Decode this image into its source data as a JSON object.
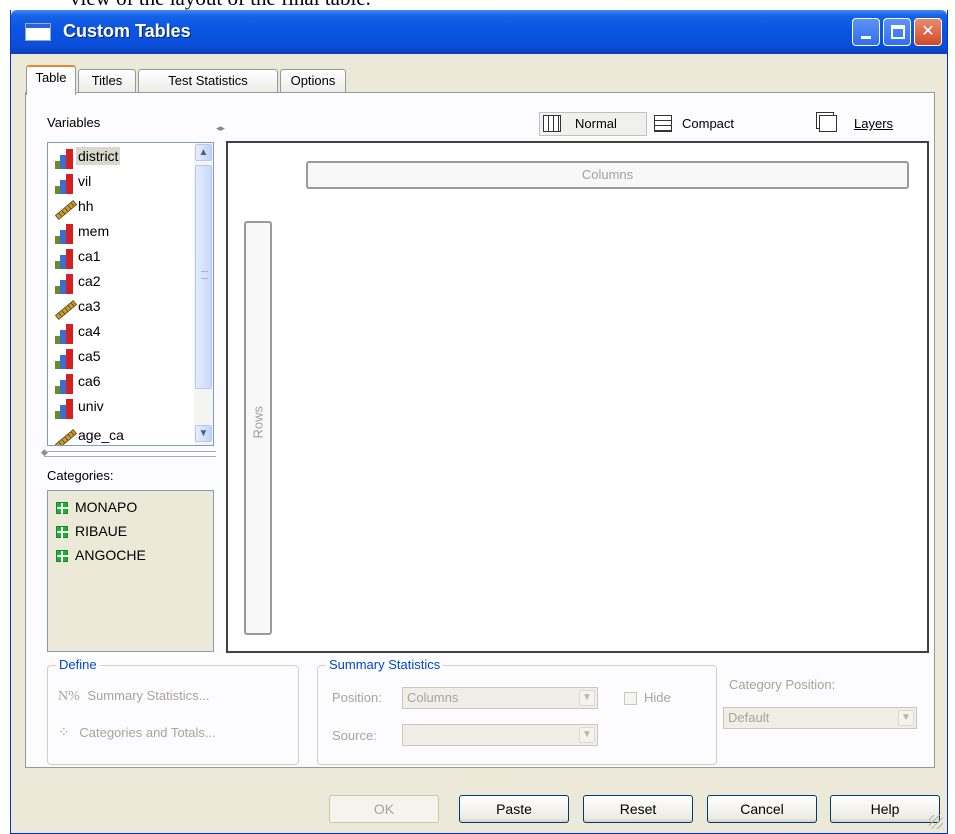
{
  "background_text": "view of the layout of the final table.",
  "window": {
    "title": "Custom Tables",
    "controls": {
      "minimize": "minimize-icon",
      "maximize": "maximize-icon",
      "close": "close-icon"
    }
  },
  "tabs": [
    {
      "label": "Table",
      "active": true
    },
    {
      "label": "Titles",
      "active": false
    },
    {
      "label": "Test Statistics",
      "active": false
    },
    {
      "label": "Options",
      "active": false
    }
  ],
  "variables": {
    "label": "Variables",
    "items": [
      {
        "name": "district",
        "icon": "nominal-bar-icon",
        "selected": true
      },
      {
        "name": "vil",
        "icon": "nominal-bar-icon"
      },
      {
        "name": "hh",
        "icon": "scale-ruler-icon"
      },
      {
        "name": "mem",
        "icon": "nominal-bar-icon"
      },
      {
        "name": "ca1",
        "icon": "nominal-bar-icon"
      },
      {
        "name": "ca2",
        "icon": "nominal-bar-icon"
      },
      {
        "name": "ca3",
        "icon": "scale-ruler-icon"
      },
      {
        "name": "ca4",
        "icon": "nominal-bar-icon"
      },
      {
        "name": "ca5",
        "icon": "nominal-bar-icon"
      },
      {
        "name": "ca6",
        "icon": "nominal-bar-icon"
      },
      {
        "name": "univ",
        "icon": "nominal-bar-icon"
      },
      {
        "name": "age_ca",
        "icon": "scale-ruler-icon"
      }
    ]
  },
  "categories": {
    "label": "Categories:",
    "items": [
      "MONAPO",
      "RIBAUE",
      "ANGOCHE"
    ]
  },
  "view": {
    "normal": "Normal",
    "compact": "Compact",
    "layers": "Layers"
  },
  "canvas": {
    "columns": "Columns",
    "rows": "Rows"
  },
  "define": {
    "legend": "Define",
    "summary_statistics": "Summary Statistics...",
    "categories_totals": "Categories and Totals...",
    "n_symbol": "N%"
  },
  "summary_statistics": {
    "legend": "Summary Statistics",
    "position_label": "Position:",
    "position_value": "Columns",
    "hide_label": "Hide",
    "source_label": "Source:",
    "source_value": ""
  },
  "category_position": {
    "label": "Category Position:",
    "value": "Default"
  },
  "buttons": {
    "ok": "OK",
    "paste": "Paste",
    "reset": "Reset",
    "cancel": "Cancel",
    "help": "Help"
  },
  "colors": {
    "titlebar": "#0a54e3",
    "dialog_bg": "#ece9d8",
    "group_legend": "#0046d5",
    "category_icon": "#19b432"
  }
}
